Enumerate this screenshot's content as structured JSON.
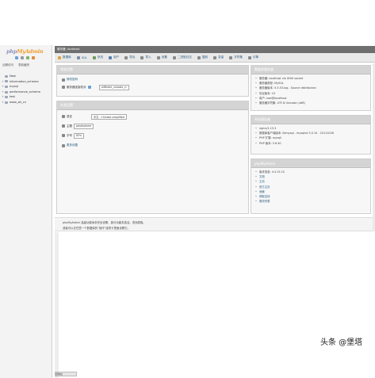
{
  "sidebar": {
    "logo": {
      "php": "php",
      "my": "My",
      "admin": "Admin"
    },
    "links": [
      "近期访问",
      "表收藏夹"
    ],
    "tree": [
      {
        "label": "New",
        "expander": ""
      },
      {
        "label": "information_schema",
        "expander": "+"
      },
      {
        "label": "mysql",
        "expander": "+"
      },
      {
        "label": "performance_schema",
        "expander": "+"
      },
      {
        "label": "test",
        "expander": "+"
      },
      {
        "label": "www_wt_cn",
        "expander": "+"
      }
    ]
  },
  "topnav": {
    "label": "服务器: localhost"
  },
  "tabs": [
    {
      "label": "数据库",
      "color": "#d9a441"
    },
    {
      "label": "SQL",
      "color": "#7b8fa6"
    },
    {
      "label": "状态",
      "color": "#6c9c5a"
    },
    {
      "label": "用户",
      "color": "#5a7fb0"
    },
    {
      "label": "导出",
      "color": "#8a8a8a"
    },
    {
      "label": "导入",
      "color": "#8a8a8a"
    },
    {
      "label": "设置",
      "color": "#8a8a8a"
    },
    {
      "label": "二进制日志",
      "color": "#8a8a8a"
    },
    {
      "label": "复制",
      "color": "#8a8a8a"
    },
    {
      "label": "变量",
      "color": "#8a8a8a"
    },
    {
      "label": "字符集",
      "color": "#8a8a8a"
    },
    {
      "label": "引擎",
      "color": "#8a8a8a"
    }
  ],
  "general": {
    "title": "常规设置",
    "change_password": "修改密码",
    "collation_label": "服务器连接校对",
    "collation_value": "utf8mb4_unicode_ci"
  },
  "appearance": {
    "title": "外观设置",
    "language_label": "语言",
    "language_value": "中文 - Chinese simplified",
    "theme_label": "主题",
    "theme_value": "pmahomme",
    "fontsize_label": "字号",
    "fontsize_value": "82%",
    "more_settings": "更多设置"
  },
  "db_server": {
    "title": "数据库服务器",
    "items": [
      "服务器: localhost via UNIX socket",
      "服务器类型: MySQL",
      "服务器版本: 5.5.53-log - Source distribution",
      "协议版本: 10",
      "用户: root@localhost",
      "服务器字符集: UTF-8 Unicode (utf8)"
    ]
  },
  "web_server": {
    "title": "网站服务器",
    "items": [
      "nginx/1.13.3",
      "数据库客户端版本: libmysql - mysqlnd 5.0.10 - 20111026",
      "PHP 扩展: mysqli",
      "PHP 版本: 5.6.40"
    ]
  },
  "phpmyadmin": {
    "title": "phpMyAdmin",
    "items": [
      "版本信息: 4.4.15.10",
      "文档",
      "主页",
      "官方主页",
      "贡献",
      "获取支持",
      "更改列表"
    ]
  },
  "notice": {
    "line1": "phpMyAdmin 高级功能尚未完全设置，部分功能未激活。查找原因。",
    "line2": "或者可以去任意一个数据库的“操作”选项卡里面设置它。"
  },
  "console_label": "控制台",
  "watermark": "头条 @堡塔"
}
